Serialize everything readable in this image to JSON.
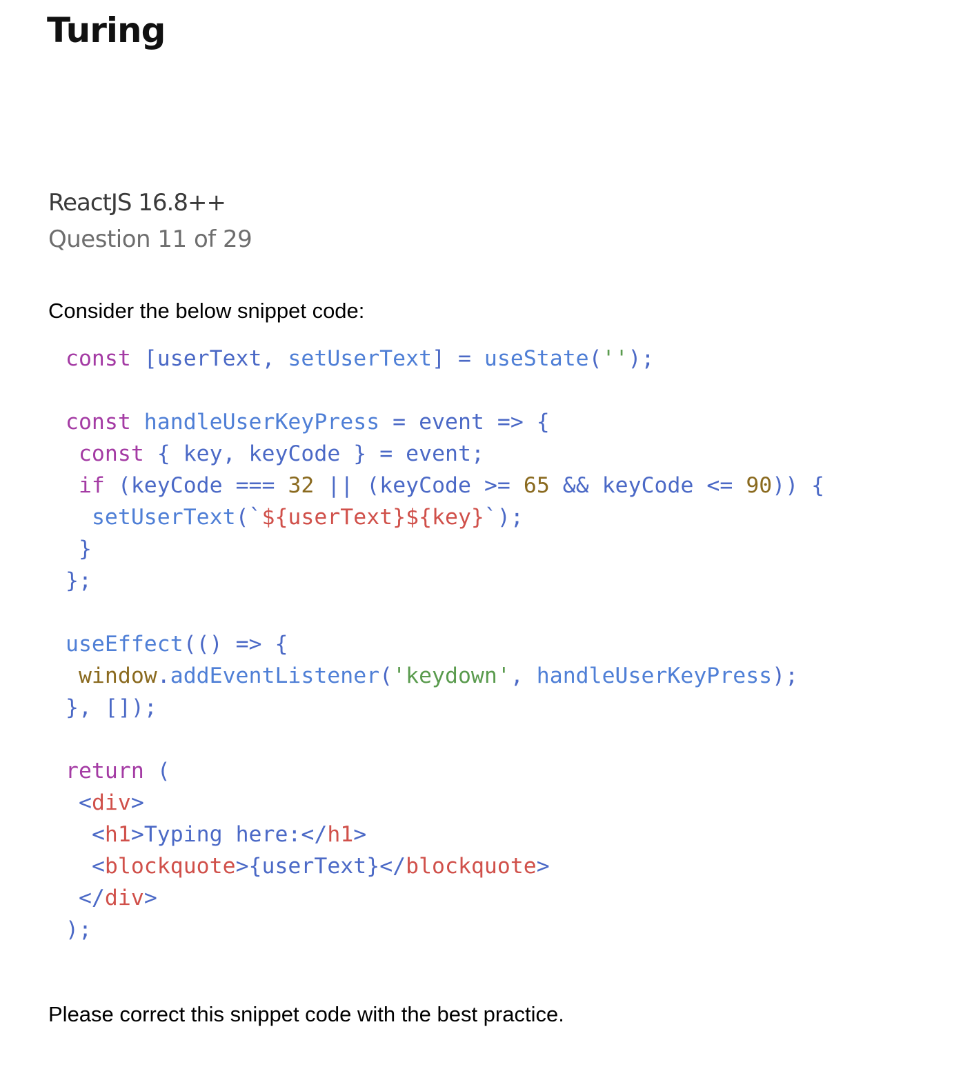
{
  "header": {
    "brand": "Turing"
  },
  "quiz": {
    "course": "ReactJS 16.8++",
    "question_counter": "Question 11 of 29",
    "prompt": "Consider the below snippet code:",
    "instruction": "Please correct this snippet code with the best practice."
  },
  "code": {
    "language": "javascript",
    "lines": [
      "const [userText, setUserText] = useState('');",
      "",
      "const handleUserKeyPress = event => {",
      " const { key, keyCode } = event;",
      " if (keyCode === 32 || (keyCode >= 65 && keyCode <= 90)) {",
      "  setUserText(`${userText}${key}`);",
      " }",
      "};",
      "",
      "useEffect(() => {",
      " window.addEventListener('keydown', handleUserKeyPress);",
      "}, []);",
      "",
      "return (",
      " <div>",
      "  <h1>Typing here:</h1>",
      "  <blockquote>{userText}</blockquote>",
      " </div>",
      ");"
    ]
  },
  "colors": {
    "keyword": "#a43ba4",
    "function": "#4f7fd6",
    "identifier": "#4b69c6",
    "number": "#8a6a1f",
    "string": "#5a9b4e",
    "template": "#d0504a",
    "tag": "#d0504a"
  }
}
